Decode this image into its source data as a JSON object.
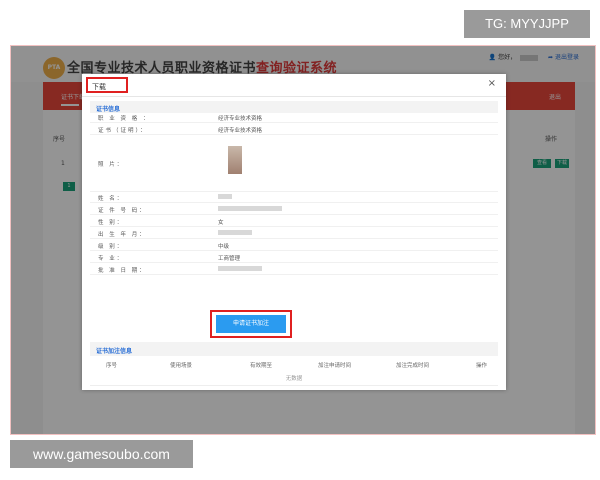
{
  "watermarks": {
    "top_right": "TG: MYYJJPP",
    "bottom_left": "www.gamesoubo.com"
  },
  "site": {
    "logo_text": "PTA",
    "title_main": "全国专业技术人员职业资格证书",
    "title_highlight": "查询验证系统",
    "user_greeting": "您好，",
    "logout_label": "退出登录"
  },
  "nav": {
    "active_item": "证书下载",
    "exit_label": "退出"
  },
  "background_table": {
    "col_index": "序号",
    "col_action": "操作",
    "row_index": "1",
    "page_number": "1",
    "btn_view": "查看",
    "btn_download": "下载"
  },
  "modal": {
    "title": "下载",
    "close_symbol": "×",
    "cert_section_title": "证书信息",
    "fields": [
      {
        "label": "职 业 资 格 ：",
        "value": "经济专业技术资格"
      },
      {
        "label": "证书（证明）：",
        "value": "经济专业技术资格"
      },
      {
        "label": "照      片：",
        "value": ""
      },
      {
        "label": "姓      名：",
        "value": ""
      },
      {
        "label": "证 件 号 码：",
        "value": ""
      },
      {
        "label": "性      别：",
        "value": "女"
      },
      {
        "label": "出 生 年 月：",
        "value": ""
      },
      {
        "label": "级      别：",
        "value": "中级"
      },
      {
        "label": "专      业：",
        "value": "工商管理"
      },
      {
        "label": "批 准 日 期：",
        "value": ""
      }
    ],
    "apply_button": "申请证书加注",
    "annotation_section_title": "证书加注信息",
    "annotation_columns": [
      "序号",
      "使用场景",
      "有效期至",
      "加注申请时间",
      "加注完成时间",
      "操作"
    ],
    "empty_text": "无数据"
  },
  "colors": {
    "brand_red": "#e9473c",
    "accent_blue": "#2b9bf0",
    "highlight_box": "#e02020",
    "action_green": "#1aa37a"
  }
}
